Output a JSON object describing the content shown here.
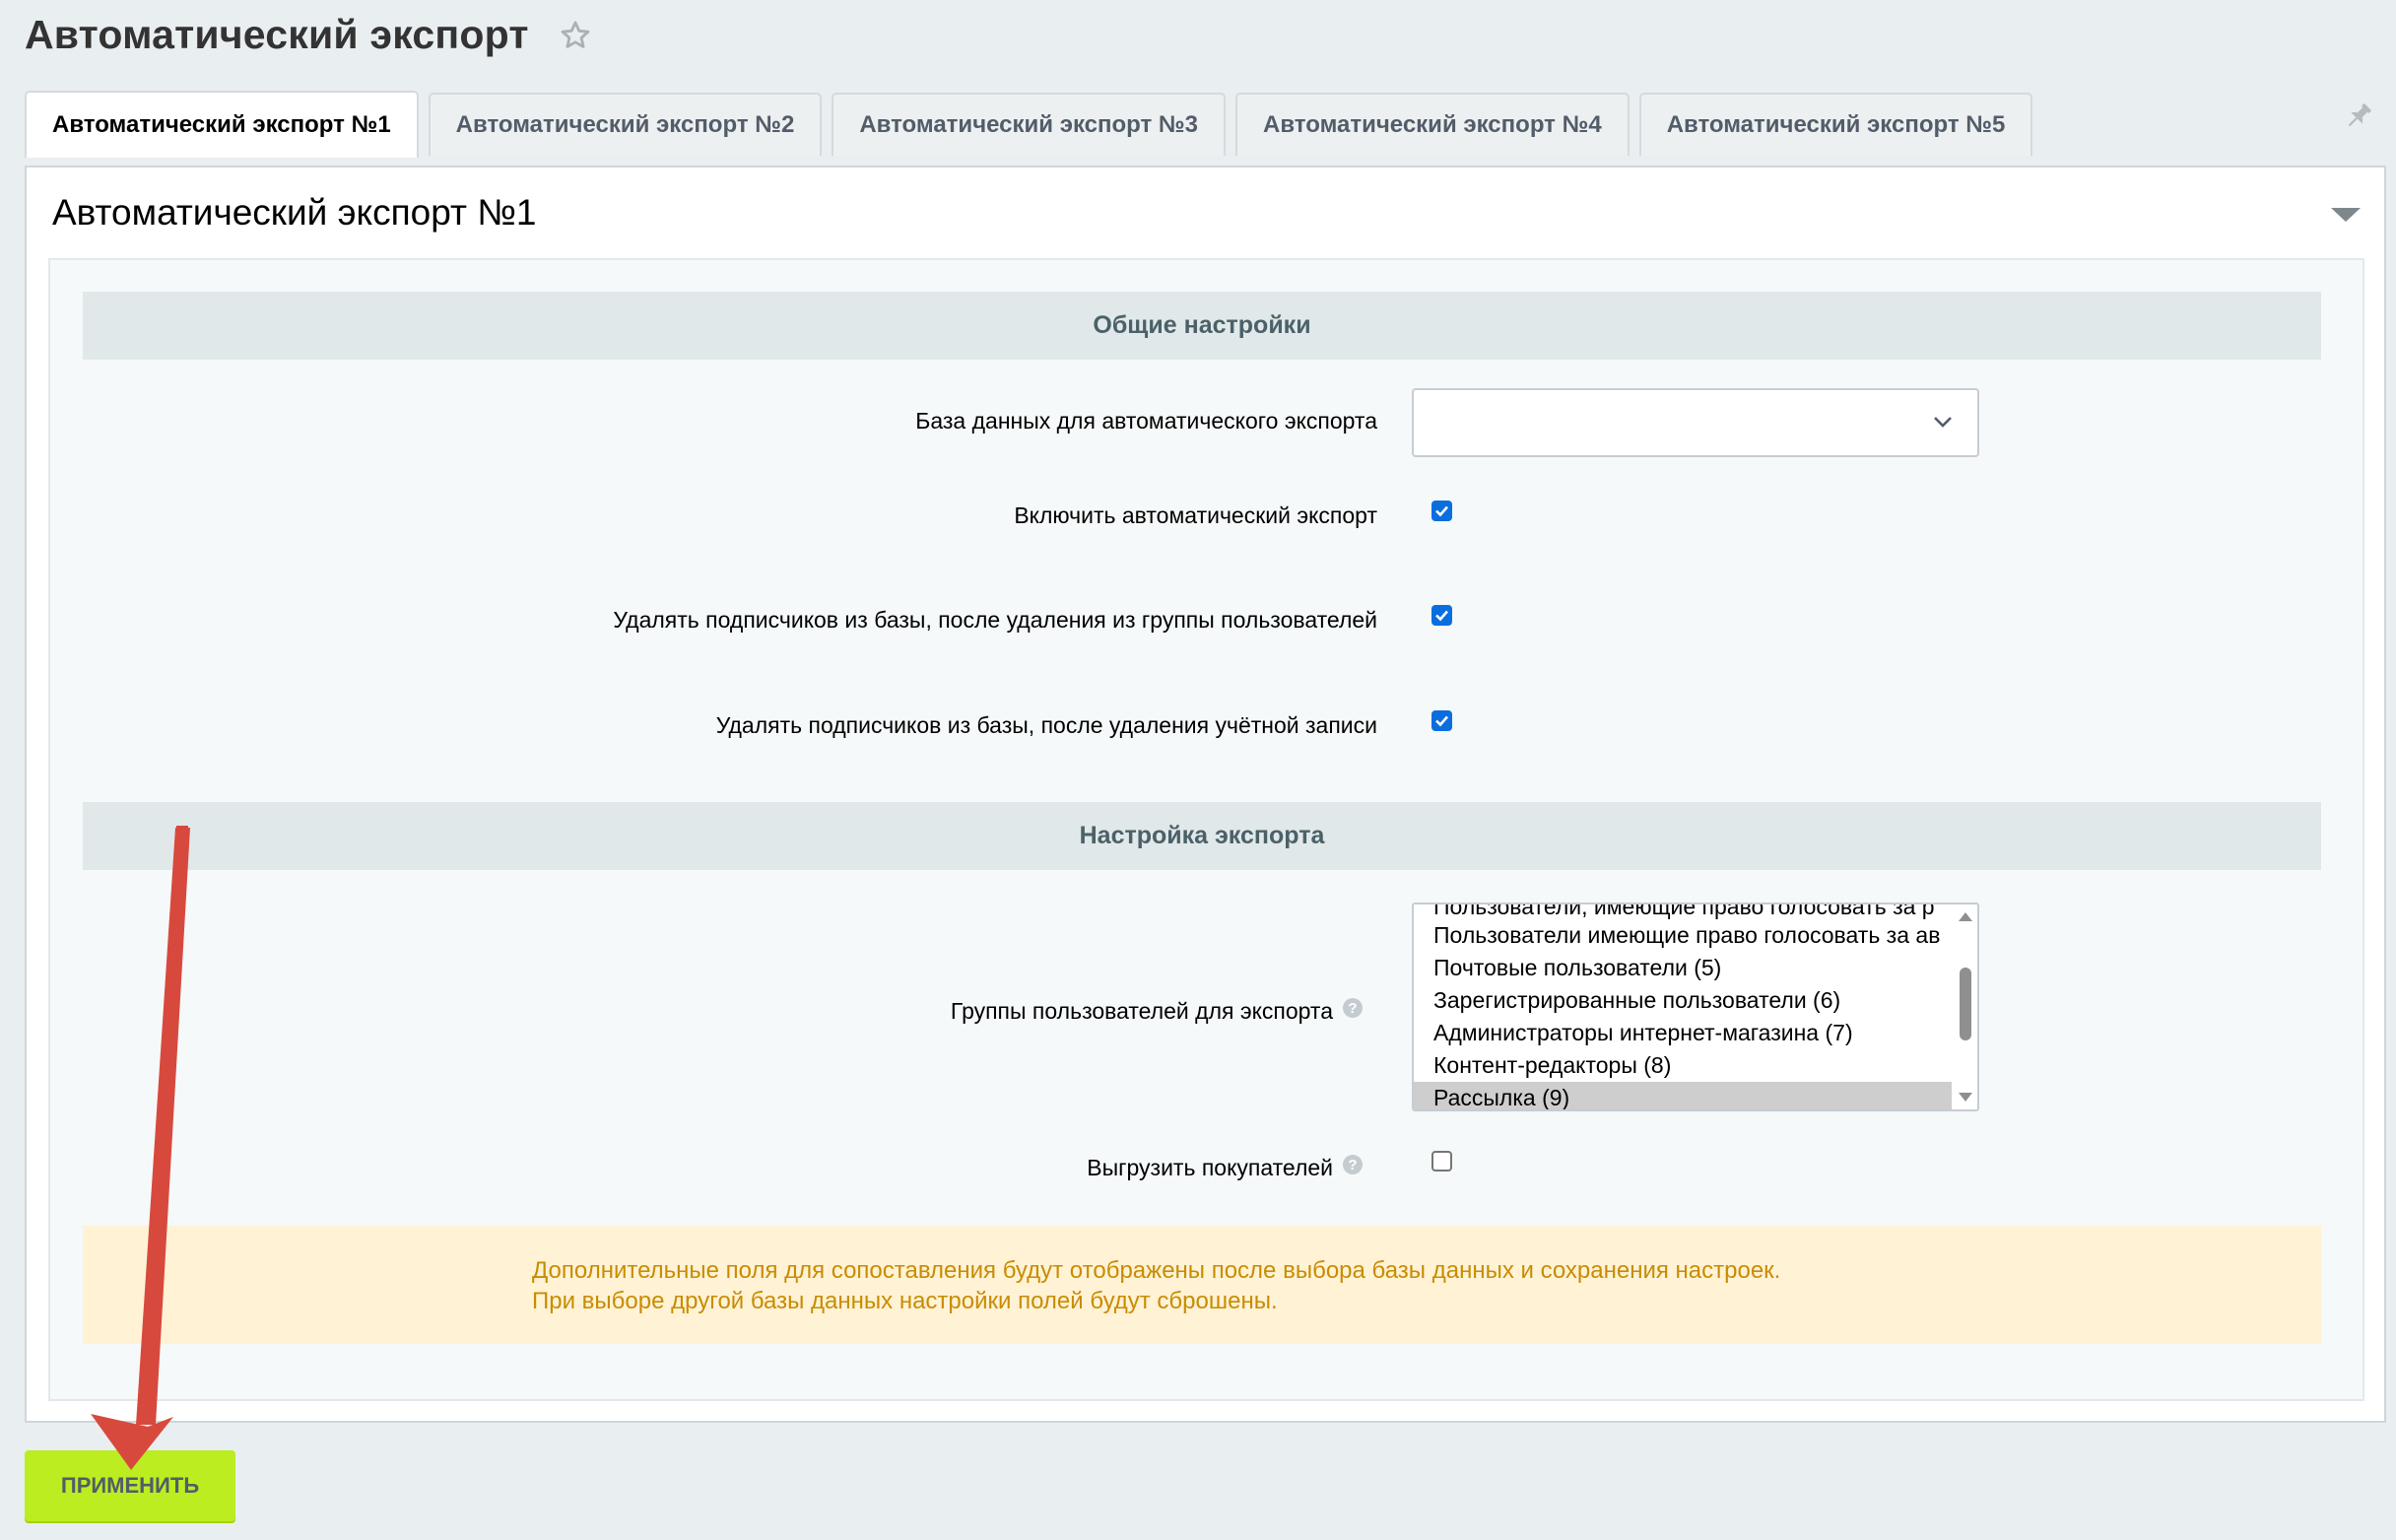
{
  "page": {
    "title": "Автоматический экспорт"
  },
  "tabs": [
    {
      "label": "Автоматический экспорт №1",
      "active": true
    },
    {
      "label": "Автоматический экспорт №2",
      "active": false
    },
    {
      "label": "Автоматический экспорт №3",
      "active": false
    },
    {
      "label": "Автоматический экспорт №4",
      "active": false
    },
    {
      "label": "Автоматический экспорт №5",
      "active": false
    }
  ],
  "card": {
    "title": "Автоматический экспорт №1"
  },
  "general_settings": {
    "header": "Общие настройки",
    "database_label": "База данных для автоматического экспорта",
    "database_value": "",
    "enable_label": "Включить автоматический экспорт",
    "enable_checked": true,
    "delete_on_group_label": "Удалять подписчиков из базы, после удаления из группы пользователей",
    "delete_on_group_checked": true,
    "delete_on_account_label": "Удалять подписчиков из базы, после удаления учётной записи",
    "delete_on_account_checked": true
  },
  "export_settings": {
    "header": "Настройка экспорта",
    "groups_label": "Группы пользователей для экспорта",
    "groups_options": [
      "Пользователи, имеющие право голосовать за р",
      "Пользователи имеющие право голосовать за ав",
      "Почтовые пользователи (5)",
      "Зарегистрированные пользователи (6)",
      "Администраторы интернет-магазина (7)",
      "Контент-редакторы (8)",
      "Рассылка (9)"
    ],
    "groups_selected": "Рассылка (9)",
    "buyers_label": "Выгрузить покупателей",
    "buyers_checked": false,
    "help_glyph": "?"
  },
  "notice": {
    "line1": "Дополнительные поля для сопоставления будут отображены после выбора базы данных и сохранения настроек.",
    "line2": "При выборе другой базы данных настройки полей будут сброшены."
  },
  "actions": {
    "apply_label": "ПРИМЕНИТЬ"
  },
  "colors": {
    "apply_button": "#bbed21",
    "checkbox_checked": "#0b6ede",
    "notice_text": "#c98c00",
    "notice_bg": "#fff2d5",
    "annotation_arrow": "#d8493d"
  },
  "icons": {
    "favorite": "star-icon",
    "pin": "pin-icon",
    "collapse": "triangle-down-icon",
    "select_caret": "chevron-down-icon",
    "help": "help-icon"
  }
}
